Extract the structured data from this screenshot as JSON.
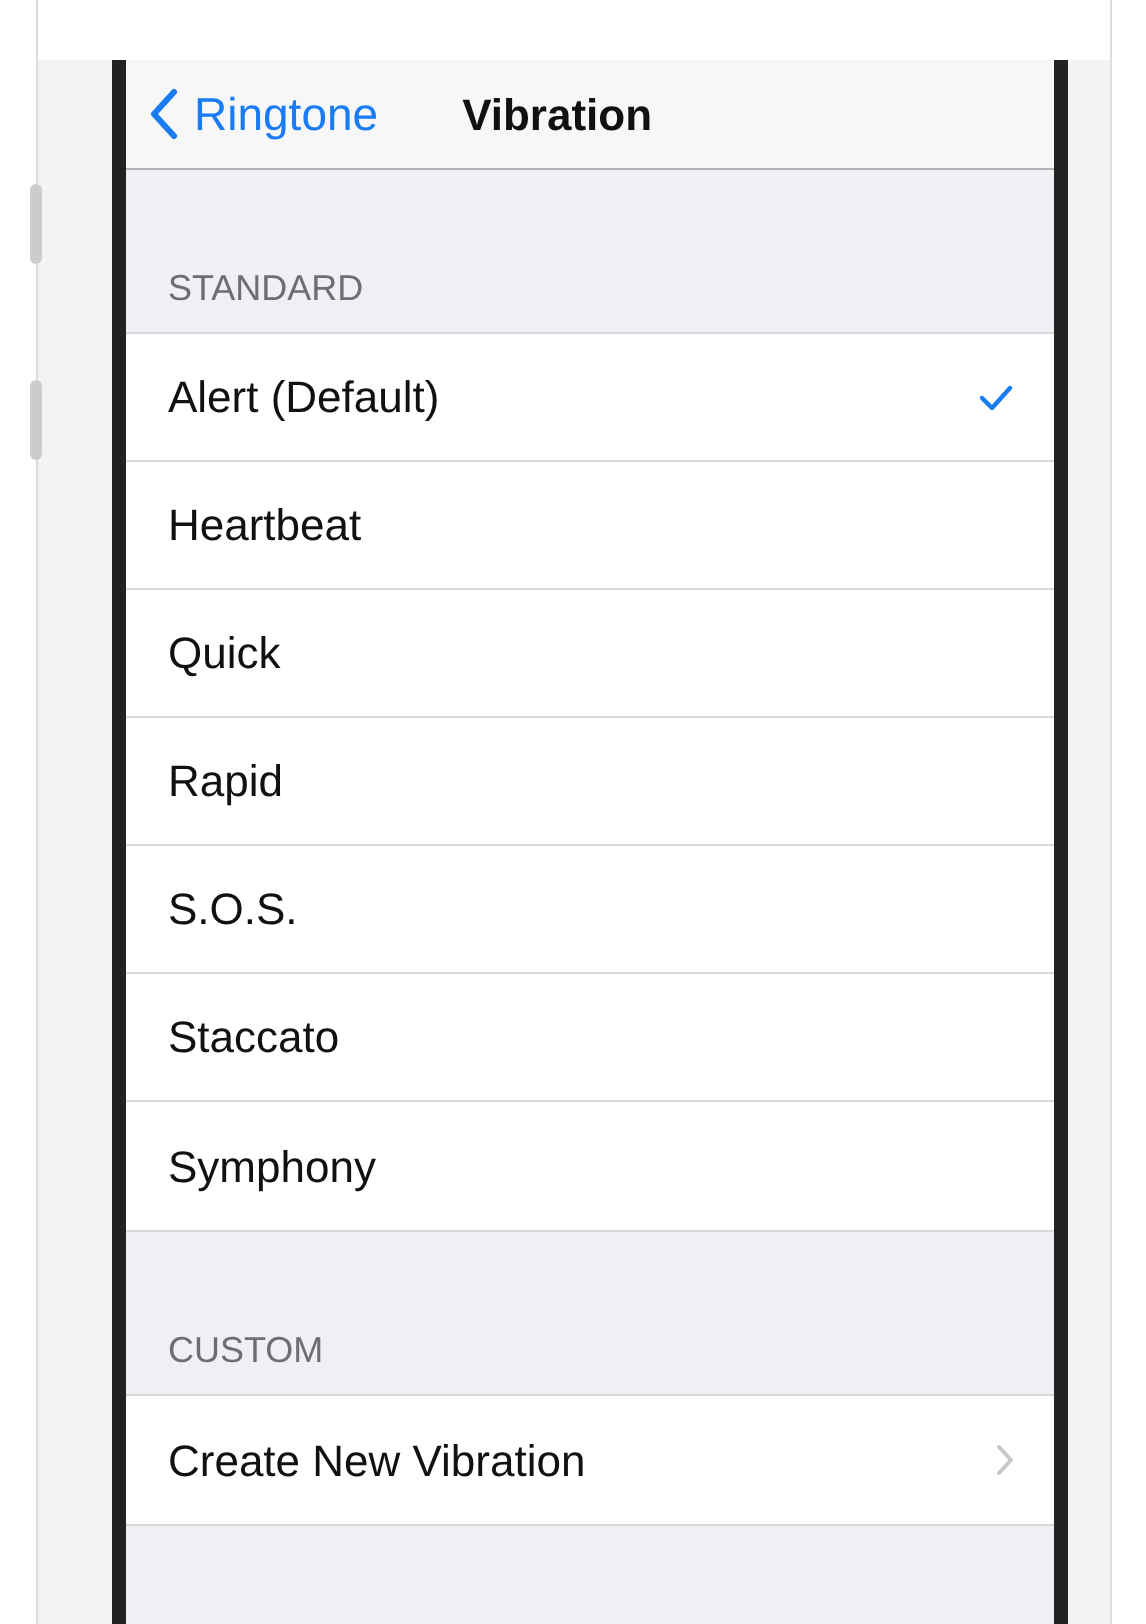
{
  "nav_bar": {
    "back_label": "Ringtone",
    "title": "Vibration"
  },
  "sections": [
    {
      "header": "STANDARD",
      "rows": [
        {
          "kind": "option",
          "label": "Alert (Default)",
          "selected": true
        },
        {
          "kind": "option",
          "label": "Heartbeat",
          "selected": false
        },
        {
          "kind": "option",
          "label": "Quick",
          "selected": false
        },
        {
          "kind": "option",
          "label": "Rapid",
          "selected": false
        },
        {
          "kind": "option",
          "label": "S.O.S.",
          "selected": false
        },
        {
          "kind": "option",
          "label": "Staccato",
          "selected": false
        },
        {
          "kind": "option",
          "label": "Symphony",
          "selected": false
        }
      ]
    },
    {
      "header": "CUSTOM",
      "rows": [
        {
          "kind": "link",
          "label": "Create New Vibration"
        }
      ]
    }
  ]
}
